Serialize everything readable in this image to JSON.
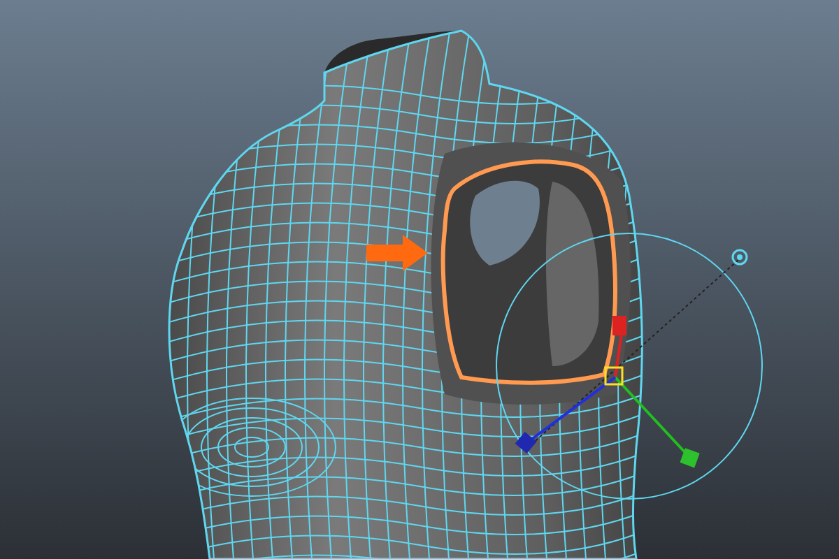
{
  "mesh": {
    "edge_loop": {
      "selected": true
    }
  }
}
